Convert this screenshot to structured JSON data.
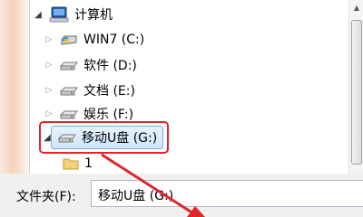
{
  "tree": {
    "root_label": "计算机",
    "drives": [
      {
        "label": "WIN7 (C:)"
      },
      {
        "label": "软件 (D:)"
      },
      {
        "label": "文档 (E:)"
      },
      {
        "label": "娱乐 (F:)"
      }
    ],
    "selected_drive": "移动U盘 (G:)",
    "child_folder": "1"
  },
  "folder_field": {
    "label": "文件夹(F):",
    "value": "移动U盘 (G:)"
  },
  "colors": {
    "highlight_border": "#e0252b",
    "selection_fill": "#cde6fb"
  }
}
